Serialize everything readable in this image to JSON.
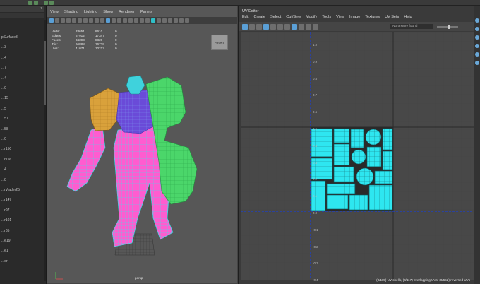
{
  "outliner": {
    "search_label": "",
    "items": [
      "pSurface3",
      "...3",
      "...4",
      "...7",
      "...4",
      "...0",
      "...15",
      "...5",
      "...57",
      "...58",
      "...0",
      "...r150",
      "...r156",
      "...4",
      "...8",
      "...rVlader25",
      "...r147",
      "...r97",
      "...r101",
      "...r85",
      "...e19",
      "...e1",
      "...er"
    ]
  },
  "viewport": {
    "menu": [
      "View",
      "Shading",
      "Lighting",
      "Show",
      "Renderer",
      "Panels"
    ],
    "hud": {
      "rows": [
        {
          "label": "Verts:",
          "a": "33651",
          "b": "8610",
          "c": "0"
        },
        {
          "label": "Edges:",
          "a": "67912",
          "b": "17347",
          "c": "0"
        },
        {
          "label": "Faces:",
          "a": "34393",
          "b": "8828",
          "c": "0"
        },
        {
          "label": "Tris:",
          "a": "66888",
          "b": "16729",
          "c": "0"
        },
        {
          "label": "UVs:",
          "a": "41071",
          "b": "10212",
          "c": "0"
        }
      ]
    },
    "viewcube_label": "FRONT",
    "camera_label": "persp"
  },
  "uv_editor": {
    "title": "UV Editor",
    "menu": [
      "Edit",
      "Create",
      "Select",
      "Cut/Sew",
      "Modify",
      "Tools",
      "View",
      "Image",
      "Textures",
      "UV Sets",
      "Help"
    ],
    "texture_field": "No texture found",
    "grid_labels_v": [
      "1.0",
      "0.9",
      "0.8",
      "0.7",
      "0.6",
      "0.5",
      "0.4",
      "0.3",
      "0.2",
      "0.1",
      "0.0",
      "-0.1",
      "-0.2",
      "-0.3",
      "-0.4"
    ],
    "status": "(0/115) UV shells, (0/117) overlapping UVs, (0/552) reversed UVs"
  },
  "colors": {
    "uv_cyan": "#2ee6f0",
    "uv_axis": "#1a3fd0",
    "mesh_pink": "#ff5cd0",
    "mesh_purple": "#6a4bd8",
    "mesh_green": "#4bd66a",
    "mesh_gold": "#d9a13b"
  }
}
